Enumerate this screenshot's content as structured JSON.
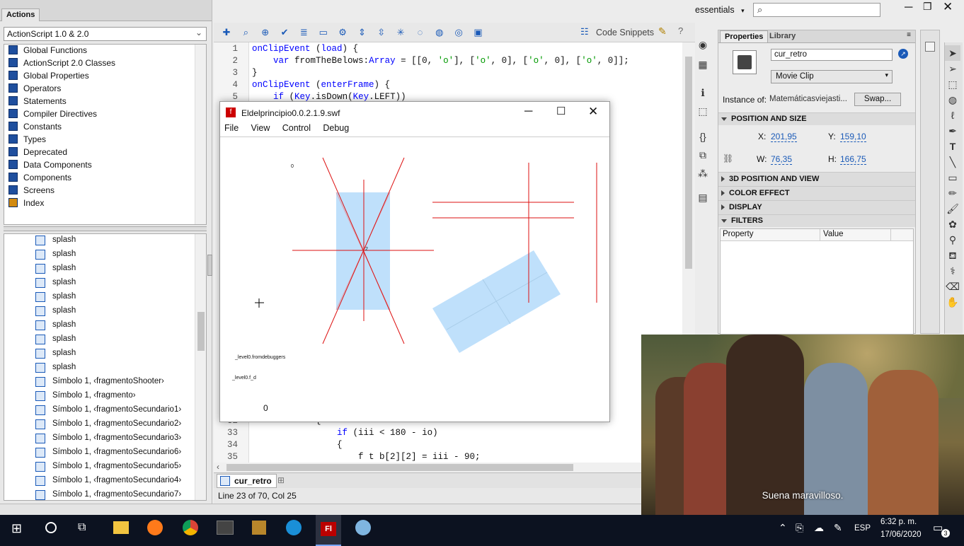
{
  "actions_panel": {
    "tab": "Actions",
    "version_select": "ActionScript 1.0 & 2.0",
    "categories": [
      "Global Functions",
      "ActionScript 2.0 Classes",
      "Global Properties",
      "Operators",
      "Statements",
      "Compiler Directives",
      "Constants",
      "Types",
      "Deprecated",
      "Data Components",
      "Components",
      "Screens",
      "Index"
    ],
    "symbols": [
      "splash",
      "splash",
      "splash",
      "splash",
      "splash",
      "splash",
      "splash",
      "splash",
      "splash",
      "splash",
      "Símbolo 1, ‹fragmentoShooter›",
      "Símbolo 1, ‹fragmento›",
      "Símbolo 1, ‹fragmentoSecundario1›",
      "Símbolo 1, ‹fragmentoSecundario2›",
      "Símbolo 1, ‹fragmentoSecundario3›",
      "Símbolo 1, ‹fragmentoSecundario6›",
      "Símbolo 1, ‹fragmentoSecundario5›",
      "Símbolo 1, ‹fragmentoSecundario4›",
      "Símbolo 1, ‹fragmentoSecundario7›"
    ]
  },
  "editor": {
    "code_snippets": "Code Snippets",
    "top_lines": [
      {
        "n": "1",
        "t": "onClipEvent (load) {"
      },
      {
        "n": "2",
        "t": "    var fromTheBelows:Array = [[0, 'o'], ['o', 0], ['o', 0], ['o', 0]];"
      },
      {
        "n": "3",
        "t": "}"
      },
      {
        "n": "4",
        "t": "onClipEvent (enterFrame) {"
      },
      {
        "n": "5",
        "t": "    if (Key.isDown(Key.LEFT))"
      }
    ],
    "bottom_lines": [
      {
        "n": "32",
        "t": "            {"
      },
      {
        "n": "33",
        "t": "                if (iii < 180 - io)"
      },
      {
        "n": "34",
        "t": "                {"
      },
      {
        "n": "35",
        "t": "                    f t b[2][2] = iii - 90;"
      }
    ],
    "tab": "cur_retro",
    "status": "Line 23 of 70, Col 25"
  },
  "swf_window": {
    "title": "Eldelprincipio0.0.2.1.9.swf",
    "menu": [
      "File",
      "View",
      "Control",
      "Debug"
    ],
    "labels": {
      "zero_small": "0",
      "level_debuggers": "_level0.fromdebuggers",
      "level_fd": "_level0.f_d",
      "zero_big": "0",
      "center_num": "2"
    }
  },
  "top_bar": {
    "workspace": "essentials",
    "search_placeholder": ""
  },
  "properties": {
    "tabs": [
      "Properties",
      "Library"
    ],
    "instance_name": "cur_retro",
    "type": "Movie Clip",
    "instance_of_label": "Instance of:",
    "instance_of": "Matemáticasviejasti...",
    "swap": "Swap...",
    "position_section": "POSITION AND SIZE",
    "x_label": "X:",
    "x": "201,95",
    "y_label": "Y:",
    "y": "159,10",
    "w_label": "W:",
    "w": "76,35",
    "h_label": "H:",
    "h": "166,75",
    "sections": [
      "3D POSITION AND VIEW",
      "COLOR EFFECT",
      "DISPLAY"
    ],
    "filters": "FILTERS",
    "col_property": "Property",
    "col_value": "Value"
  },
  "video": {
    "subtitle": "Suena maravilloso."
  },
  "taskbar": {
    "lang": "ESP",
    "time": "6:32 p. m.",
    "date": "17/06/2020",
    "notif_count": "3"
  },
  "colors": {
    "accent": "#1a5ab8",
    "red_line": "#dd1111",
    "clip_fill": "#bfe0fb",
    "taskbar": "#0c1220"
  }
}
